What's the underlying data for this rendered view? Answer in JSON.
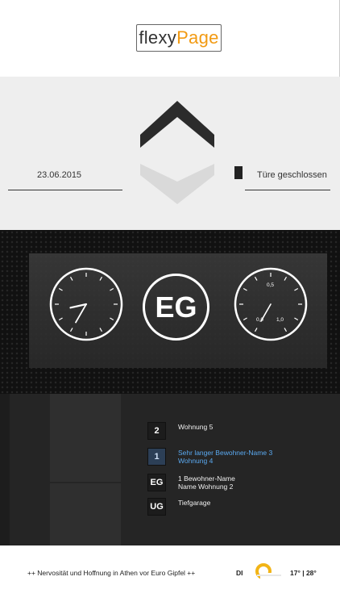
{
  "header": {
    "logo_part1": "flexy",
    "logo_part2": "Page"
  },
  "status": {
    "date": "23.06.2015",
    "door": "Türe geschlossen",
    "direction": "up",
    "colors": {
      "arrow_active": "#2b2b2b",
      "arrow_inactive": "#d9d9d9"
    }
  },
  "dashboard": {
    "current_floor": "EG",
    "clock": {
      "hour": 8,
      "minute": 35
    },
    "speed_gauge": {
      "labels": {
        "min": "0,0",
        "mid": "0,5",
        "max": "1,0"
      },
      "value": 0.6
    }
  },
  "floors": [
    {
      "number": "2",
      "line1": "Wohnung 5",
      "line2": "",
      "active": false
    },
    {
      "number": "1",
      "line1": "Sehr langer Bewohner-Name 3",
      "line2": "Wohnung 4",
      "active": true
    },
    {
      "number": "EG",
      "line1": "1 Bewohner-Name",
      "line2": "Name Wohnung 2",
      "active": false
    },
    {
      "number": "UG",
      "line1": "Tiefgarage",
      "line2": "",
      "active": false
    }
  ],
  "ticker": {
    "news": "++ Nervosität und Hoffnung in Athen vor Euro Gipfel ++",
    "day": "DI",
    "weather_icon": "partly-sunny-icon",
    "temps": "17° | 28°",
    "colors": {
      "sun": "#f2b416"
    }
  }
}
